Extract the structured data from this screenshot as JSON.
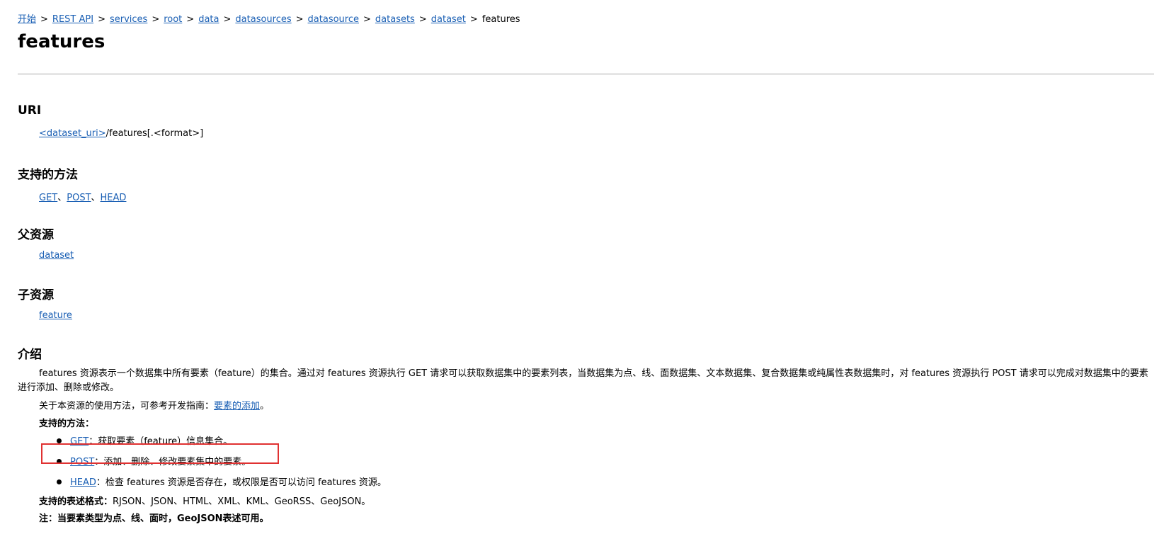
{
  "breadcrumb": {
    "items": [
      "开始",
      "REST API",
      "services",
      "root",
      "data",
      "datasources",
      "datasource",
      "datasets",
      "dataset"
    ],
    "separator": ">",
    "current": "features"
  },
  "page_title": "features",
  "sections": {
    "uri": {
      "title": "URI",
      "link": "<dataset_uri>",
      "suffix": "/features[.<format>]"
    },
    "methods": {
      "title": "支持的方法",
      "links": [
        "GET",
        "POST",
        "HEAD"
      ],
      "separator": "、"
    },
    "parent": {
      "title": "父资源",
      "link": "dataset"
    },
    "child": {
      "title": "子资源",
      "link": "feature"
    },
    "intro": {
      "title": "介绍",
      "paragraph": "features 资源表示一个数据集中所有要素（feature）的集合。通过对 features 资源执行 GET 请求可以获取数据集中的要素列表，当数据集为点、线、面数据集、文本数据集、复合数据集或纯属性表数据集时，对 features 资源执行 POST 请求可以完成对数据集中的要素进行添加、删除或修改。",
      "guide_prefix": "关于本资源的使用方法，可参考开发指南：",
      "guide_link": "要素的添加",
      "guide_suffix": "。",
      "supported_methods_label": "支持的方法：",
      "method_items": [
        {
          "method": "GET",
          "desc": "：获取要素（feature）信息集合。"
        },
        {
          "method": "POST",
          "desc": "：添加、删除、修改要素集中的要素。"
        },
        {
          "method": "HEAD",
          "desc": "：检查 features 资源是否存在，或权限是否可以访问 features 资源。"
        }
      ],
      "formats_label": "支持的表述格式：",
      "formats_value": "RJSON、JSON、HTML、XML、KML、GeoRSS、GeoJSON。",
      "note": "注：当要素类型为点、线、面时，GeoJSON表述可用。"
    }
  },
  "colors": {
    "link": "#1a5fb4",
    "highlight_box": "#e03131",
    "divider": "#a8a8a8"
  }
}
